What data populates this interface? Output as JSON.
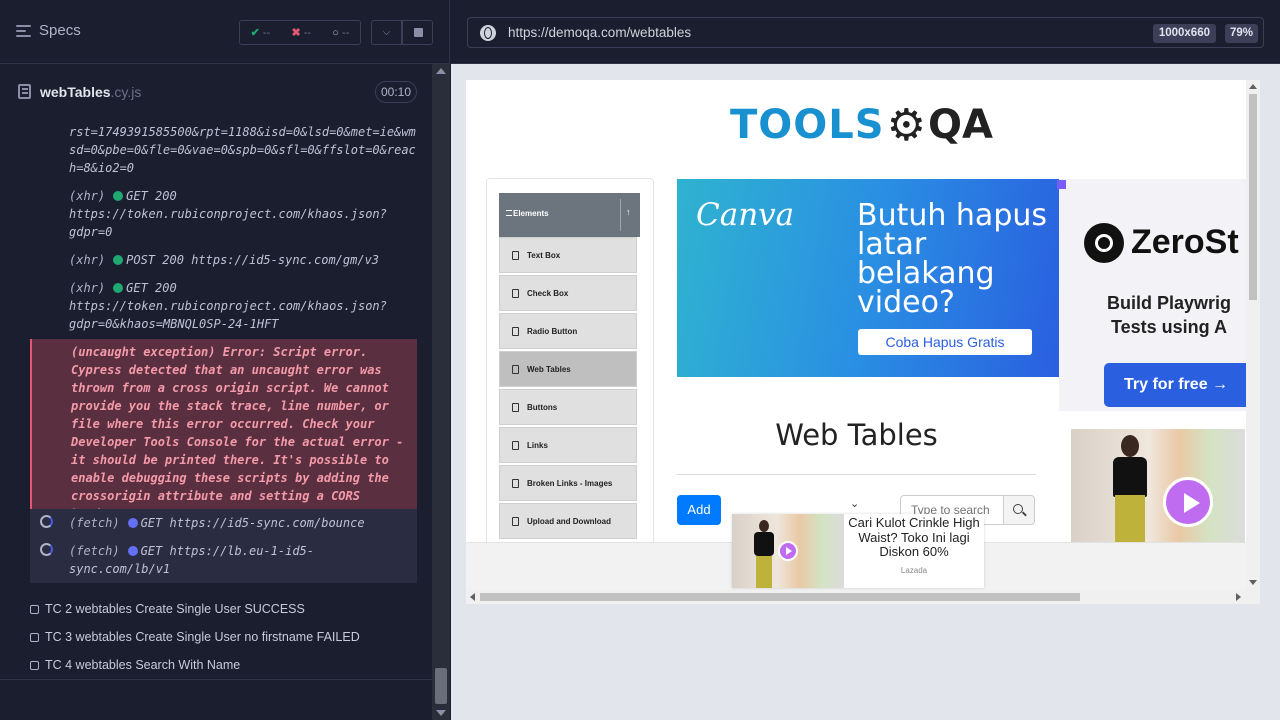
{
  "specs_bar": {
    "title": "Specs",
    "stats": {
      "passed": "--",
      "failed": "--",
      "pending": "--"
    }
  },
  "spec_file": {
    "name": "webTables",
    "ext": ".cy.js",
    "duration": "00:10"
  },
  "log": {
    "truncated_lines": [
      "rst=1749391585500&rpt=1188&isd=0&lsd=0&met=ie&wm",
      "sd=0&pbe=0&fle=0&vae=0&spb=0&sfl=0&ffslot=0&reac",
      "h=8&io2=0"
    ],
    "entries": [
      {
        "kind": "(xhr)",
        "method": "GET",
        "status": "200",
        "lines": [
          "https://token.rubiconproject.com/khaos.json?",
          "gdpr=0"
        ]
      },
      {
        "kind": "(xhr)",
        "method": "POST",
        "status": "200",
        "lines": [
          "https://id5-sync.com/gm/v3"
        ]
      },
      {
        "kind": "(xhr)",
        "method": "GET",
        "status": "200",
        "lines": [
          "https://token.rubiconproject.com/khaos.json?",
          "gdpr=0&khaos=MBNQL0SP-24-1HFT"
        ]
      }
    ],
    "error": {
      "lines": [
        "(uncaught exception)  Error: Script error.",
        "Cypress detected that an uncaught error was",
        "thrown from a cross origin script. We cannot",
        "provide you the stack trace, line number, or",
        "file where this error occurred. Check your",
        "Developer Tools Console for the actual error -",
        "it should be printed there. It's possible to",
        "enable debugging these scripts by adding the",
        "crossorigin attribute and setting a CORS header."
      ]
    },
    "fetches": [
      {
        "kind": "(fetch)",
        "method": "GET",
        "lines": [
          "https://id5-sync.com/bounce"
        ]
      },
      {
        "kind": "(fetch)",
        "method": "GET",
        "lines": [
          "https://lb.eu-1-id5-",
          "sync.com/lb/v1"
        ]
      }
    ]
  },
  "tests": [
    "TC 2 webtables Create Single User SUCCESS",
    "TC 3 webtables Create Single User no firstname FAILED",
    "TC 4 webtables Search With Name"
  ],
  "browser": {
    "url": "https://demoqa.com/webtables",
    "viewport": "1000x660",
    "zoom": "79%"
  },
  "site": {
    "logo_tools": "TOOLS",
    "logo_qa": "QA",
    "sidebar_header": "Elements",
    "sidebar_items": [
      "Text Box",
      "Check Box",
      "Radio Button",
      "Web Tables",
      "Buttons",
      "Links",
      "Broken Links - Images",
      "Upload and Download"
    ],
    "active_item": "Web Tables",
    "page_title": "Web Tables",
    "add_label": "Add",
    "search_placeholder": "Type to search"
  },
  "ads": {
    "canva": {
      "logo": "Canva",
      "headline": [
        "Butuh hapus",
        "latar belakang",
        "video?"
      ],
      "cta": "Coba Hapus Gratis"
    },
    "zerostep": {
      "name": "ZeroSt",
      "text": [
        "Build Playwrig",
        "Tests using A"
      ],
      "cta": "Try for free →"
    },
    "lazada": {
      "text": "Cari Kulot Crinkle High Waist? Toko Ini lagi Diskon 60%",
      "brand": "Lazada"
    }
  },
  "colors": {
    "pass": "#1fa971",
    "fail": "#e45770",
    "accent": "#4956e3",
    "add_button": "#007bff",
    "logo_blue": "#1991d0"
  }
}
